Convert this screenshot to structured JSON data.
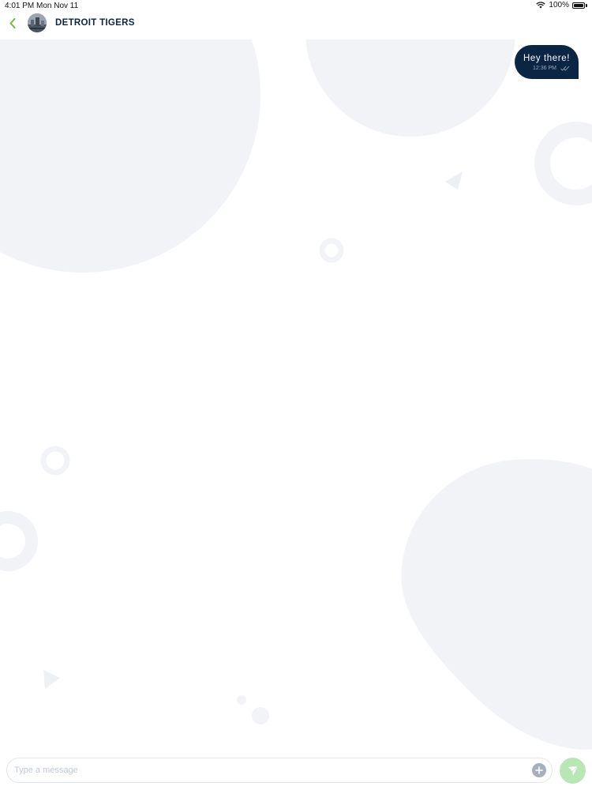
{
  "status_bar": {
    "time": "4:01 PM",
    "date": "Mon Nov 11",
    "battery": "100%"
  },
  "header": {
    "back_icon": "chevron-left-icon",
    "contact_name": "DETROIT TIGERS"
  },
  "messages": [
    {
      "text": "Hey there!",
      "time": "12:36 PM",
      "status_icon": "double-check-icon",
      "direction": "outgoing"
    }
  ],
  "input": {
    "placeholder": "Type a message",
    "value": "",
    "add_icon": "plus-circle-icon",
    "send_icon": "send-icon"
  },
  "colors": {
    "brand_navy": "#0b2545",
    "accent_green": "#7cb342",
    "send_green": "#b9e6b5",
    "bg_shape": "#f1f3f7"
  }
}
